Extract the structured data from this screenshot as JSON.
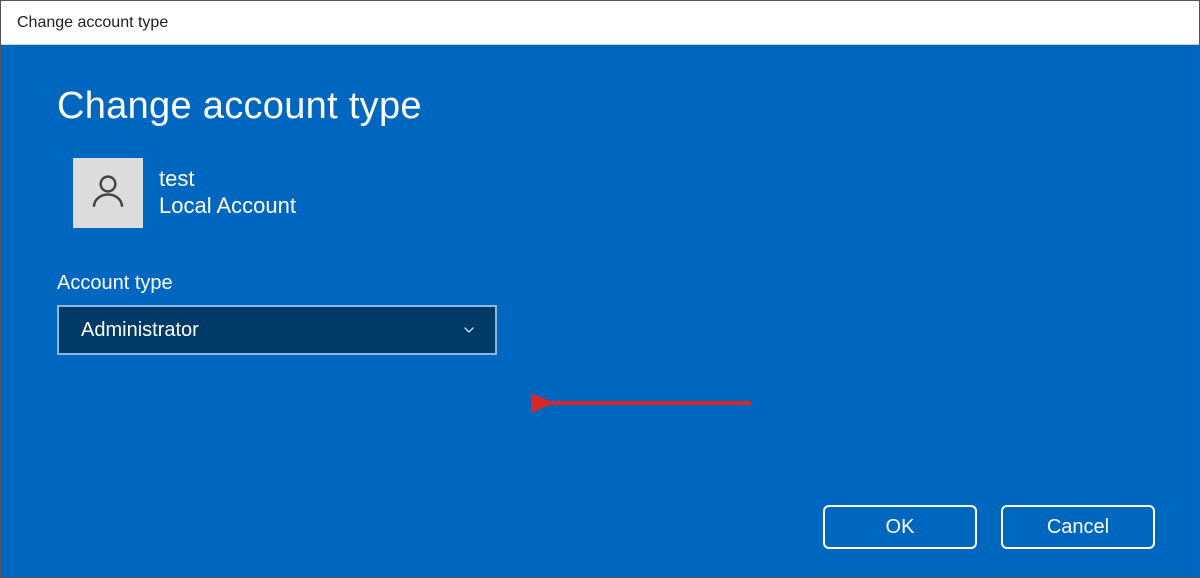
{
  "window": {
    "title": "Change account type"
  },
  "page": {
    "heading": "Change account type"
  },
  "user": {
    "name": "test",
    "kind": "Local Account"
  },
  "field": {
    "label": "Account type",
    "selected": "Administrator"
  },
  "buttons": {
    "ok": "OK",
    "cancel": "Cancel"
  },
  "annotation": {
    "color": "#d62828"
  }
}
